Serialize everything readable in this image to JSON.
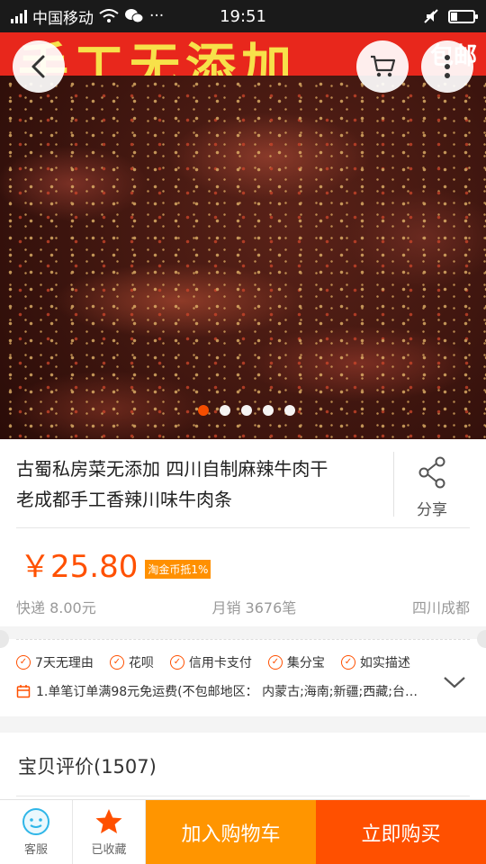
{
  "status_bar": {
    "carrier": "中国移动",
    "more": "···",
    "time": "19:51"
  },
  "hero": {
    "banner_text": "手工无添加",
    "banner_tag": "包邮",
    "slide_count": 5,
    "active_slide": 0
  },
  "nav": {
    "back_icon": "chevron-left-icon",
    "cart_icon": "cart-icon",
    "more_icon": "more-vertical-icon"
  },
  "product": {
    "title_line1": "古蜀私房菜无添加 四川自制麻辣牛肉干",
    "title_line2": "老成都手工香辣川味牛肉条",
    "share_label": "分享",
    "price": "￥25.80",
    "coin_badge": "淘金币抵1%",
    "shipping": "快递 8.00元",
    "monthly_sales": "月销 3676笔",
    "location": "四川成都"
  },
  "services": {
    "items": [
      "7天无理由",
      "花呗",
      "信用卡支付",
      "集分宝",
      "如实描述"
    ],
    "shipping_promo": "1.单笔订单满98元免运费(不包邮地区：  内蒙古;海南;新疆;西藏;台…"
  },
  "reviews": {
    "title": "宝贝评价(1507)"
  },
  "bottom_bar": {
    "service_label": "客服",
    "favorite_label": "已收藏",
    "add_to_cart_label": "加入购物车",
    "buy_now_label": "立即购买"
  },
  "colors": {
    "accent": "#ff5000",
    "cart_button": "#ff9500",
    "badge": "#ff9000"
  }
}
